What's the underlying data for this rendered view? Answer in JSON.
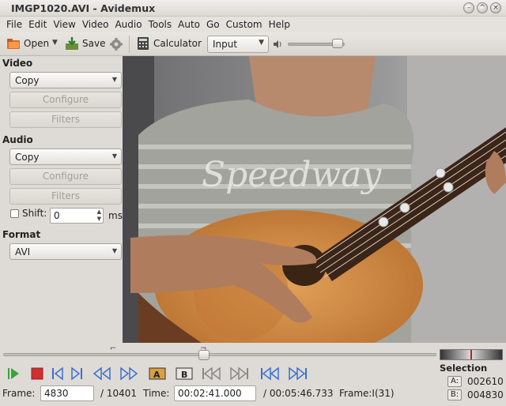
{
  "window": {
    "title": "IMGP1020.AVI - Avidemux"
  },
  "menu": [
    "File",
    "Edit",
    "View",
    "Video",
    "Audio",
    "Tools",
    "Auto",
    "Go",
    "Custom",
    "Help"
  ],
  "toolbar": {
    "open_label": "Open",
    "save_label": "Save",
    "calculator_label": "Calculator",
    "input_value": "Input",
    "icons": [
      "open-icon",
      "save-icon",
      "settings-gear-icon",
      "calculator-icon",
      "volume-icon"
    ]
  },
  "video_section": {
    "heading": "Video",
    "codec_value": "Copy",
    "configure_label": "Configure",
    "filters_label": "Filters"
  },
  "audio_section": {
    "heading": "Audio",
    "codec_value": "Copy",
    "configure_label": "Configure",
    "filters_label": "Filters",
    "shift_label": "Shift:",
    "shift_value": "0",
    "shift_unit": "ms"
  },
  "format_section": {
    "heading": "Format",
    "container_value": "AVI"
  },
  "navigation": {
    "frame_label": "Frame:",
    "frame_value": "4830",
    "frame_total": "/ 10401",
    "time_label": "Time:",
    "time_value": "00:02:41.000",
    "time_total": "/ 00:05:46.733",
    "frame_type": "Frame:I(31)",
    "seek_position_fraction": 0.464
  },
  "selection": {
    "heading": "Selection",
    "a_label": "A:",
    "a_value": "002610",
    "b_label": "B:",
    "b_value": "004830"
  },
  "transport_icons": [
    "play-icon",
    "stop-icon",
    "previous-frame-icon",
    "next-frame-icon",
    "rewind-icon",
    "fast-forward-icon",
    "set-marker-a-icon",
    "set-marker-b-icon",
    "previous-black-frame-icon",
    "next-black-frame-icon",
    "first-frame-icon",
    "last-frame-icon"
  ],
  "colors": {
    "play_green": "#3aa23a",
    "stop_red": "#d03030",
    "transport_blue": "#3b6fd1"
  }
}
